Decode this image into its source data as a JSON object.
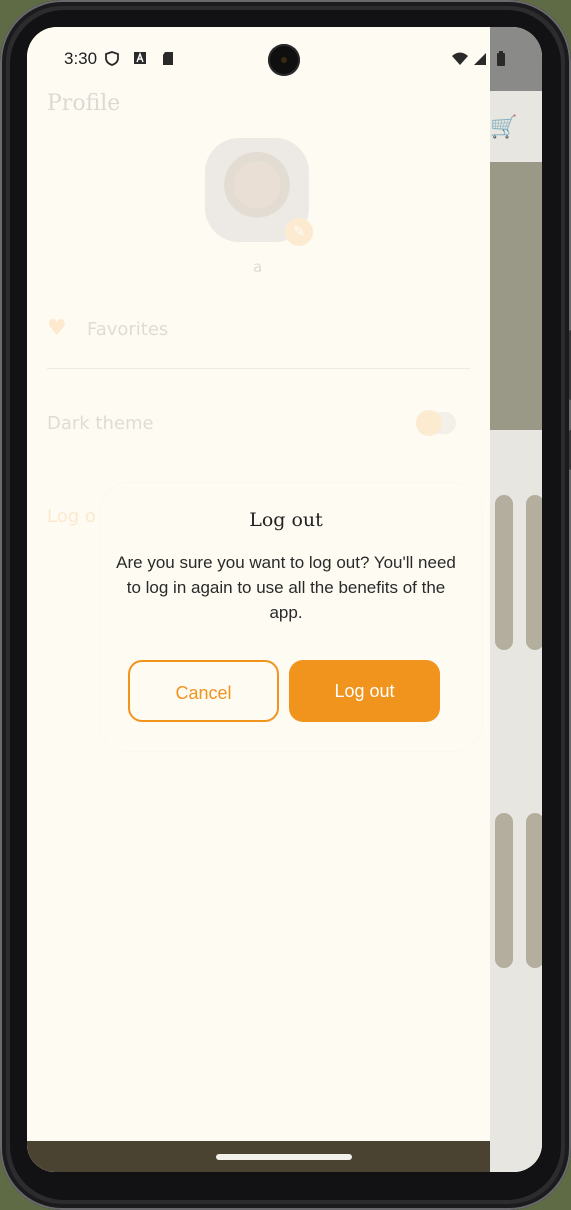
{
  "status_bar": {
    "time": "3:30",
    "left_icons": [
      "shield-icon",
      "font-icon",
      "sd-card-icon"
    ],
    "right_icons": [
      "wifi-icon",
      "signal-icon",
      "battery-icon"
    ]
  },
  "drawer": {
    "title": "Profile",
    "user_name": "a",
    "menu": {
      "favorites_label": "Favorites",
      "dark_theme_label": "Dark theme",
      "dark_theme_on": false,
      "logout_label": "Log o"
    }
  },
  "dialog": {
    "title": "Log out",
    "message": "Are you sure you want to log out? You'll need to log in again to use all the benefits of the app.",
    "cancel_label": "Cancel",
    "confirm_label": "Log out"
  },
  "colors": {
    "accent": "#f0941e",
    "surface": "#fefbf3",
    "nav_bar": "#4a4332"
  }
}
